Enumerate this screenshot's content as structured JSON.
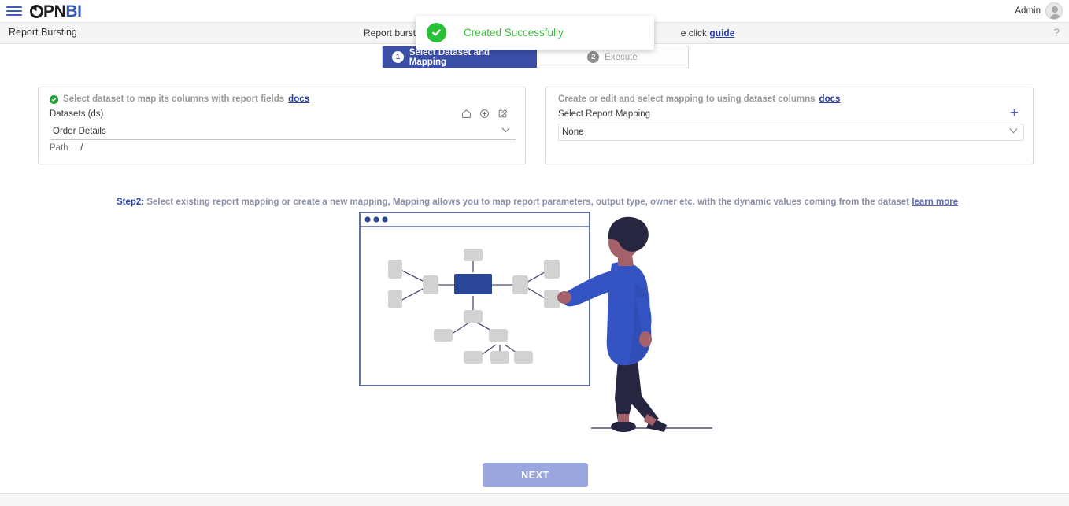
{
  "app": {
    "logo_pie": "pie-chart-icon",
    "logo_dark": "PN",
    "logo_blue": "BI",
    "menu_icon": "hamburger-menu-icon"
  },
  "header": {
    "admin_label": "Admin",
    "avatar_icon": "user-avatar-icon"
  },
  "subheader": {
    "title": "Report Bursting",
    "description_prefix": "Report burst",
    "description_suffix": "e click ",
    "guide_link": "guide",
    "help_icon": "?"
  },
  "toast": {
    "message": "Created Successfully",
    "icon": "check-circle-icon",
    "icon_color": "#27c037",
    "text_color": "#3cbf3c"
  },
  "stepper": {
    "steps": [
      {
        "number": "1",
        "label": "Select Dataset and Mapping",
        "active": true
      },
      {
        "number": "2",
        "label": "Execute",
        "active": false
      }
    ],
    "active_color": "#3b4ea8"
  },
  "left_card": {
    "hint": "Select dataset to map its columns with report fields",
    "hint_link": "docs",
    "field_label": "Datasets (ds)",
    "selected_value": "Order Details",
    "path_label": "Path :",
    "path_value": "/",
    "icons": [
      "home-icon",
      "add-circle-icon",
      "edit-square-icon"
    ]
  },
  "right_card": {
    "hint": "Create or edit and select mapping to using dataset columns",
    "hint_link": "docs",
    "field_label": "Select Report Mapping",
    "selected_value": "None",
    "add_icon": "plus-icon"
  },
  "step2": {
    "prefix": "Step2:",
    "text": "Select existing report mapping or create a new mapping, Mapping allows you to map report parameters, output type, owner etc. with the dynamic values coming from the dataset",
    "link": "learn more"
  },
  "illustration": {
    "name": "mapping-diagram-illustration",
    "window_dots": 3,
    "accent_node_color": "#2b4697",
    "node_color": "#d2d2d2",
    "person_jacket_color": "#3454c4",
    "person_pants_color": "#272641",
    "person_skin_color": "#a5616a"
  },
  "footer_button": {
    "label": "NEXT",
    "color": "#9aa6dd",
    "disabled": true
  }
}
